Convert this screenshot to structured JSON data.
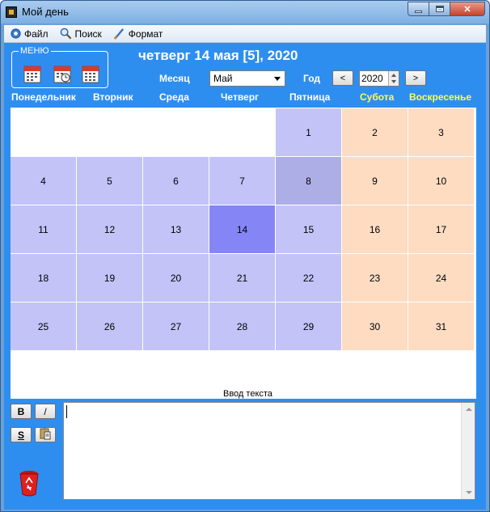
{
  "window": {
    "title": "Мой день"
  },
  "menubar": {
    "items": [
      {
        "label": "Файл",
        "icon": "gear-icon"
      },
      {
        "label": "Поиск",
        "icon": "search-icon"
      },
      {
        "label": "Формат",
        "icon": "brush-icon"
      }
    ]
  },
  "menu_group": {
    "label": "МЕНЮ",
    "icons": [
      "calendar-icon",
      "calendar-clock-icon",
      "calendar-grid-icon"
    ]
  },
  "header": {
    "date_title": "четверг 14 мая [5], 2020"
  },
  "controls": {
    "month_label": "Месяц",
    "month_value": "Май",
    "year_label": "Год",
    "year_value": "2020",
    "prev": "<",
    "next": ">"
  },
  "weekdays": [
    "Понедельник",
    "Вторник",
    "Среда",
    "Четверг",
    "Пятница",
    "Субота",
    "Воскресенье"
  ],
  "calendar": {
    "today": 14,
    "selected_previous": 8,
    "weeks": [
      [
        "",
        "",
        "",
        "",
        "1",
        "2",
        "3"
      ],
      [
        "4",
        "5",
        "6",
        "7",
        "8",
        "9",
        "10"
      ],
      [
        "11",
        "12",
        "13",
        "14",
        "15",
        "16",
        "17"
      ],
      [
        "18",
        "19",
        "20",
        "21",
        "22",
        "23",
        "24"
      ],
      [
        "25",
        "26",
        "27",
        "28",
        "29",
        "30",
        "31"
      ]
    ]
  },
  "editor": {
    "label": "Ввод текста",
    "bold": "B",
    "italic": "/",
    "strike": "S"
  },
  "colors": {
    "panel": "#2e8ef0",
    "weekday_cell": "#c3c3f8",
    "weekend_cell": "#fddcc2",
    "today_cell": "#8585f5",
    "weekend_header": "#ffff4a"
  }
}
